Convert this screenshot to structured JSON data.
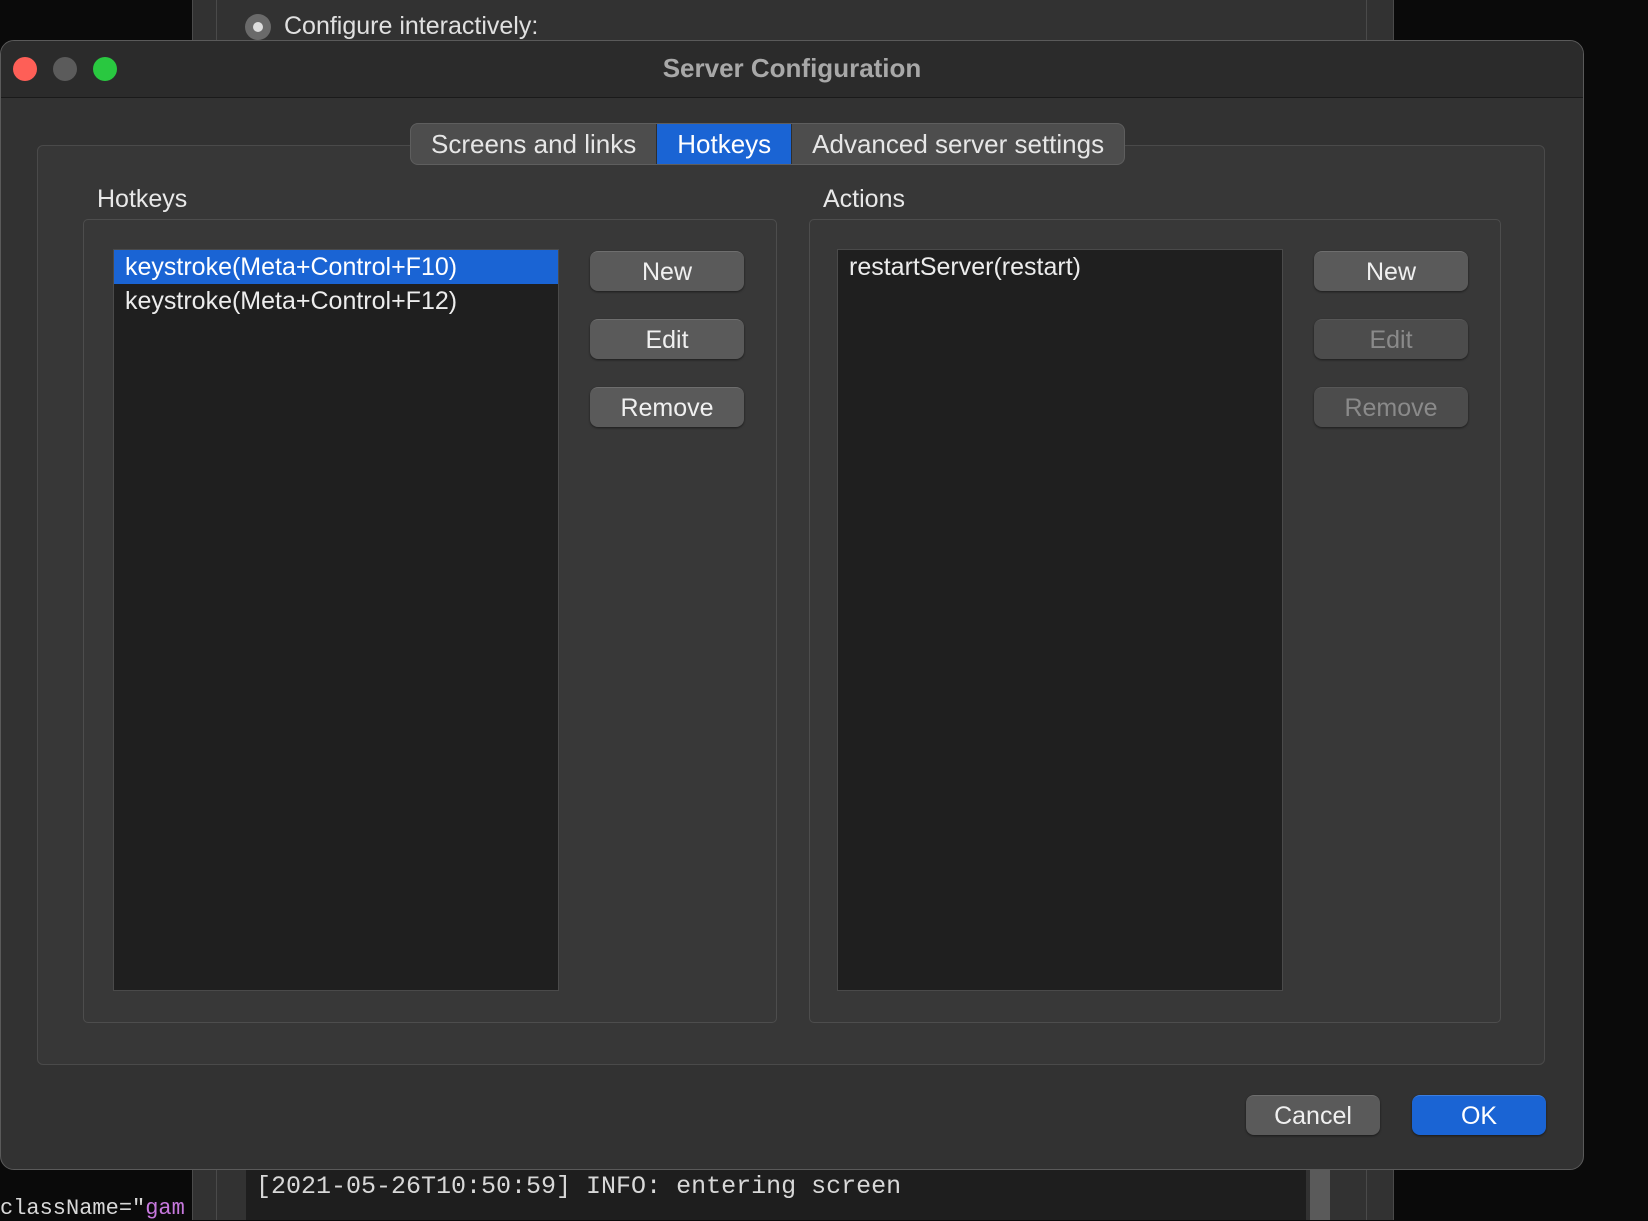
{
  "background": {
    "radio_label": "Configure interactively:",
    "log_line": "[2021-05-26T10:50:59] INFO: entering screen",
    "code_prefix": "className=\"",
    "code_attr": "gam"
  },
  "dialog": {
    "title": "Server Configuration",
    "tabs": [
      {
        "label": "Screens and links",
        "active": false
      },
      {
        "label": "Hotkeys",
        "active": true
      },
      {
        "label": "Advanced server settings",
        "active": false
      }
    ],
    "hotkeys": {
      "label": "Hotkeys",
      "items": [
        "keystroke(Meta+Control+F10)",
        "keystroke(Meta+Control+F12)"
      ],
      "selected_index": 0,
      "buttons": {
        "new": "New",
        "edit": "Edit",
        "remove": "Remove"
      }
    },
    "actions": {
      "label": "Actions",
      "items": [
        "restartServer(restart)"
      ],
      "buttons": {
        "new": "New",
        "edit": "Edit",
        "remove": "Remove"
      },
      "edit_enabled": false,
      "remove_enabled": false
    },
    "footer": {
      "cancel": "Cancel",
      "ok": "OK"
    }
  },
  "colors": {
    "accent": "#1a64d4",
    "close": "#fe5f57",
    "maximize": "#29c840"
  }
}
